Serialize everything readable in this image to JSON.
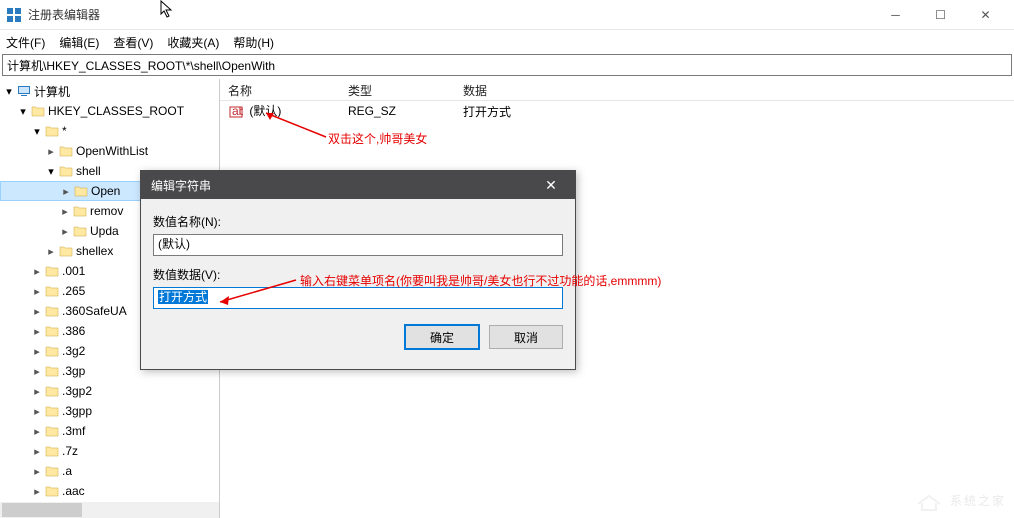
{
  "window": {
    "title": "注册表编辑器"
  },
  "menu": {
    "file": "文件(F)",
    "edit": "编辑(E)",
    "view": "查看(V)",
    "favorites": "收藏夹(A)",
    "help": "帮助(H)"
  },
  "address": {
    "path": "计算机\\HKEY_CLASSES_ROOT\\*\\shell\\OpenWith"
  },
  "tree": {
    "root": "计算机",
    "hive": "HKEY_CLASSES_ROOT",
    "star": "*",
    "openWithList": "OpenWithList",
    "shell": "shell",
    "openwith": "Open",
    "remove": "remov",
    "update": "Upda",
    "shellex": "shellex",
    "ext001": ".001",
    "ext265": ".265",
    "ext360": ".360SafeUA",
    "ext386": ".386",
    "ext3g2": ".3g2",
    "ext3gp": ".3gp",
    "ext3gp2": ".3gp2",
    "ext3gpp": ".3gpp",
    "ext3mf": ".3mf",
    "ext7z": ".7z",
    "exta": ".a",
    "extaac": ".aac"
  },
  "list": {
    "headers": {
      "name": "名称",
      "type": "类型",
      "data": "数据"
    },
    "row": {
      "name": "(默认)",
      "type": "REG_SZ",
      "data": "打开方式"
    }
  },
  "dialog": {
    "title": "编辑字符串",
    "name_label": "数值名称(N):",
    "name_value": "(默认)",
    "data_label": "数值数据(V):",
    "data_value": "打开方式",
    "ok": "确定",
    "cancel": "取消"
  },
  "annotations": {
    "a1": "双击这个,帅哥美女",
    "a2": "输入右键菜单项名(你要叫我是帅哥/美女也行不过功能的话,emmmm)"
  },
  "watermark": "系统之家"
}
